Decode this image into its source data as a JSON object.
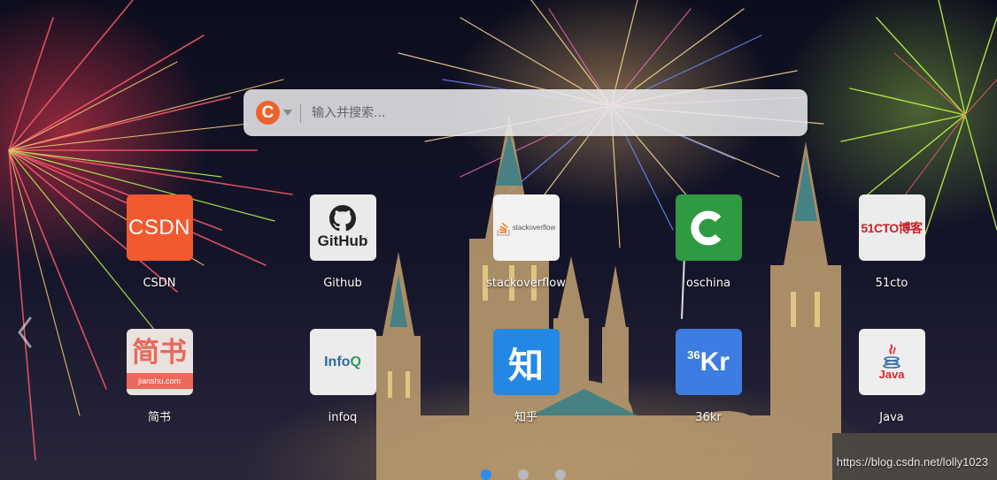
{
  "search": {
    "engine_letter": "C",
    "placeholder": "输入并搜索..."
  },
  "tiles": [
    {
      "label": "CSDN",
      "icon": "csdn-logo",
      "logo_text": "CSDN",
      "color": "#f15a2f"
    },
    {
      "label": "Github",
      "icon": "github-logo",
      "logo_text": "GitHub",
      "color": "#eaeaea"
    },
    {
      "label": "stackoverflow",
      "icon": "stackoverflow-logo",
      "logo_text": "stackoverflow",
      "color": "#f2f2f2"
    },
    {
      "label": "oschina",
      "icon": "oschina-logo",
      "logo_text": "C",
      "color": "#2e9a41"
    },
    {
      "label": "51cto",
      "icon": "51cto-logo",
      "logo_text": "51CTO博客",
      "color": "#ececec"
    },
    {
      "label": "简书",
      "icon": "jianshu-logo",
      "logo_text": "简书",
      "logo_sub": "jianshu.com",
      "color": "#e9695b"
    },
    {
      "label": "infoq",
      "icon": "infoq-logo",
      "logo_text": "Info",
      "logo_text_q": "Q",
      "color": "#ececec"
    },
    {
      "label": "知乎",
      "icon": "zhihu-logo",
      "logo_text": "知",
      "color": "#2288e4"
    },
    {
      "label": "36kr",
      "icon": "36kr-logo",
      "logo_text_36": "36",
      "logo_text_kr": "Kr",
      "color": "#3d7ce0"
    },
    {
      "label": "Java",
      "icon": "java-logo",
      "logo_text": "Java",
      "color": "#eeeeee"
    }
  ],
  "pagination": {
    "pages": 3,
    "active": 0
  },
  "watermark": "https://blog.csdn.net/lolly1023",
  "colors": {
    "accent": "#2d8cf0",
    "engine": "#f0622d"
  }
}
